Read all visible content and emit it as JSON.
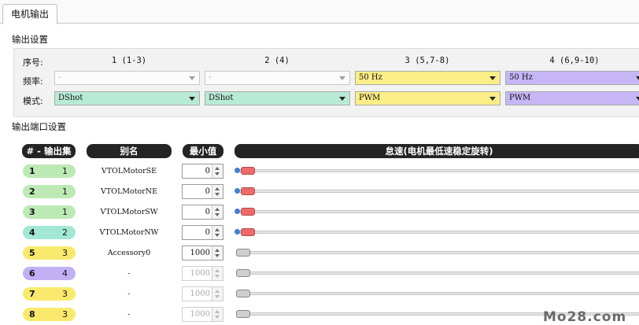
{
  "tab": {
    "label": "电机输出"
  },
  "output_settings": {
    "title": "输出设置",
    "labels": {
      "index": "序号:",
      "frequency": "频率:",
      "mode": "模式:"
    },
    "columns": [
      {
        "header": "1 (1-3)",
        "frequency": "-",
        "mode": "DShot"
      },
      {
        "header": "2 (4)",
        "frequency": "-",
        "mode": "DShot"
      },
      {
        "header": "3 (5,7-8)",
        "frequency": "50 Hz",
        "mode": "PWM"
      },
      {
        "header": "4 (6,9-10)",
        "frequency": "50 Hz",
        "mode": "PWM"
      }
    ]
  },
  "port_settings": {
    "title": "输出端口设置",
    "headers": {
      "output_set": "# - 输出集",
      "alias": "别名",
      "min": "最小值",
      "idle": "怠速(电机最低速稳定旋转)"
    },
    "rows": [
      {
        "num": "1",
        "set": "1",
        "alias": "VTOLMotorSE",
        "min": "0"
      },
      {
        "num": "2",
        "set": "1",
        "alias": "VTOLMotorNE",
        "min": "0"
      },
      {
        "num": "3",
        "set": "1",
        "alias": "VTOLMotorSW",
        "min": "0"
      },
      {
        "num": "4",
        "set": "2",
        "alias": "VTOLMotorNW",
        "min": "0"
      },
      {
        "num": "5",
        "set": "3",
        "alias": "Accessory0",
        "min": "1000"
      },
      {
        "num": "6",
        "set": "4",
        "alias": "-",
        "min": "1000"
      },
      {
        "num": "7",
        "set": "3",
        "alias": "-",
        "min": "1000"
      },
      {
        "num": "8",
        "set": "3",
        "alias": "-",
        "min": "1000"
      }
    ]
  },
  "colors": {
    "set1": "#bde9b5",
    "set2": "#a2e8d4",
    "set3": "#f9ea6e",
    "set4": "#c2b0f5",
    "motor_handle": "#f06a6a"
  },
  "watermark": "Mo28.com"
}
